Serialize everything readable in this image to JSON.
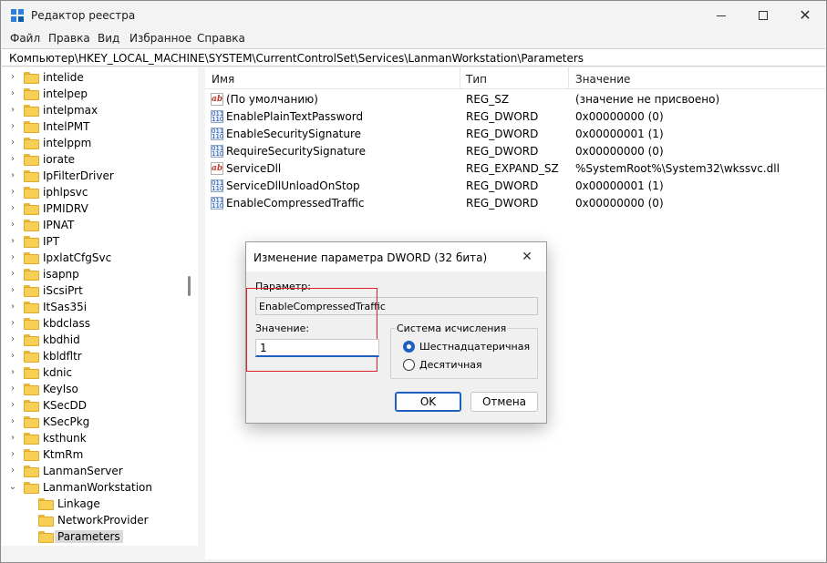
{
  "window": {
    "title": "Редактор реестра"
  },
  "menu": [
    "Файл",
    "Правка",
    "Вид",
    "Избранное",
    "Справка"
  ],
  "address": "Компьютер\\HKEY_LOCAL_MACHINE\\SYSTEM\\CurrentControlSet\\Services\\LanmanWorkstation\\Parameters",
  "tree": [
    {
      "label": "intelide",
      "level": 0,
      "expander": "collapsed"
    },
    {
      "label": "intelpep",
      "level": 0,
      "expander": "collapsed"
    },
    {
      "label": "intelpmax",
      "level": 0,
      "expander": "collapsed"
    },
    {
      "label": "IntelPMT",
      "level": 0,
      "expander": "collapsed"
    },
    {
      "label": "intelppm",
      "level": 0,
      "expander": "collapsed"
    },
    {
      "label": "iorate",
      "level": 0,
      "expander": "collapsed"
    },
    {
      "label": "IpFilterDriver",
      "level": 0,
      "expander": "collapsed"
    },
    {
      "label": "iphlpsvc",
      "level": 0,
      "expander": "collapsed"
    },
    {
      "label": "IPMIDRV",
      "level": 0,
      "expander": "collapsed"
    },
    {
      "label": "IPNAT",
      "level": 0,
      "expander": "collapsed"
    },
    {
      "label": "IPT",
      "level": 0,
      "expander": "collapsed"
    },
    {
      "label": "IpxlatCfgSvc",
      "level": 0,
      "expander": "collapsed"
    },
    {
      "label": "isapnp",
      "level": 0,
      "expander": "collapsed"
    },
    {
      "label": "iScsiPrt",
      "level": 0,
      "expander": "collapsed"
    },
    {
      "label": "ItSas35i",
      "level": 0,
      "expander": "collapsed"
    },
    {
      "label": "kbdclass",
      "level": 0,
      "expander": "collapsed"
    },
    {
      "label": "kbdhid",
      "level": 0,
      "expander": "collapsed"
    },
    {
      "label": "kbldfltr",
      "level": 0,
      "expander": "collapsed"
    },
    {
      "label": "kdnic",
      "level": 0,
      "expander": "collapsed"
    },
    {
      "label": "KeyIso",
      "level": 0,
      "expander": "collapsed"
    },
    {
      "label": "KSecDD",
      "level": 0,
      "expander": "collapsed"
    },
    {
      "label": "KSecPkg",
      "level": 0,
      "expander": "collapsed"
    },
    {
      "label": "ksthunk",
      "level": 0,
      "expander": "collapsed"
    },
    {
      "label": "KtmRm",
      "level": 0,
      "expander": "collapsed"
    },
    {
      "label": "LanmanServer",
      "level": 0,
      "expander": "collapsed"
    },
    {
      "label": "LanmanWorkstation",
      "level": 0,
      "expander": "expanded"
    },
    {
      "label": "Linkage",
      "level": 1,
      "expander": "none"
    },
    {
      "label": "NetworkProvider",
      "level": 1,
      "expander": "none"
    },
    {
      "label": "Parameters",
      "level": 1,
      "expander": "none",
      "selected": true
    }
  ],
  "list": {
    "columns": [
      "Имя",
      "Тип",
      "Значение"
    ],
    "rows": [
      {
        "icon": "string-value-icon",
        "name": "(По умолчанию)",
        "type": "REG_SZ",
        "value": "(значение не присвоено)"
      },
      {
        "icon": "binary-value-icon",
        "name": "EnablePlainTextPassword",
        "type": "REG_DWORD",
        "value": "0x00000000 (0)"
      },
      {
        "icon": "binary-value-icon",
        "name": "EnableSecuritySignature",
        "type": "REG_DWORD",
        "value": "0x00000001 (1)"
      },
      {
        "icon": "binary-value-icon",
        "name": "RequireSecuritySignature",
        "type": "REG_DWORD",
        "value": "0x00000000 (0)"
      },
      {
        "icon": "string-value-icon",
        "name": "ServiceDll",
        "type": "REG_EXPAND_SZ",
        "value": "%SystemRoot%\\System32\\wkssvc.dll"
      },
      {
        "icon": "binary-value-icon",
        "name": "ServiceDllUnloadOnStop",
        "type": "REG_DWORD",
        "value": "0x00000001 (1)"
      },
      {
        "icon": "binary-value-icon",
        "name": "EnableCompressedTraffic",
        "type": "REG_DWORD",
        "value": "0x00000000 (0)"
      }
    ]
  },
  "dialog": {
    "title": "Изменение параметра DWORD (32 бита)",
    "param_label": "Параметр:",
    "param_value": "EnableCompressedTraffic",
    "value_label": "Значение:",
    "value": "1",
    "base_group": "Система исчисления",
    "base_hex": "Шестнадцатеричная",
    "base_dec": "Десятичная",
    "ok": "OK",
    "cancel": "Отмена"
  },
  "colors": {
    "accent": "#1f5fbf",
    "highlight_frame": "#e0202a",
    "folder": "#f7cf55"
  }
}
